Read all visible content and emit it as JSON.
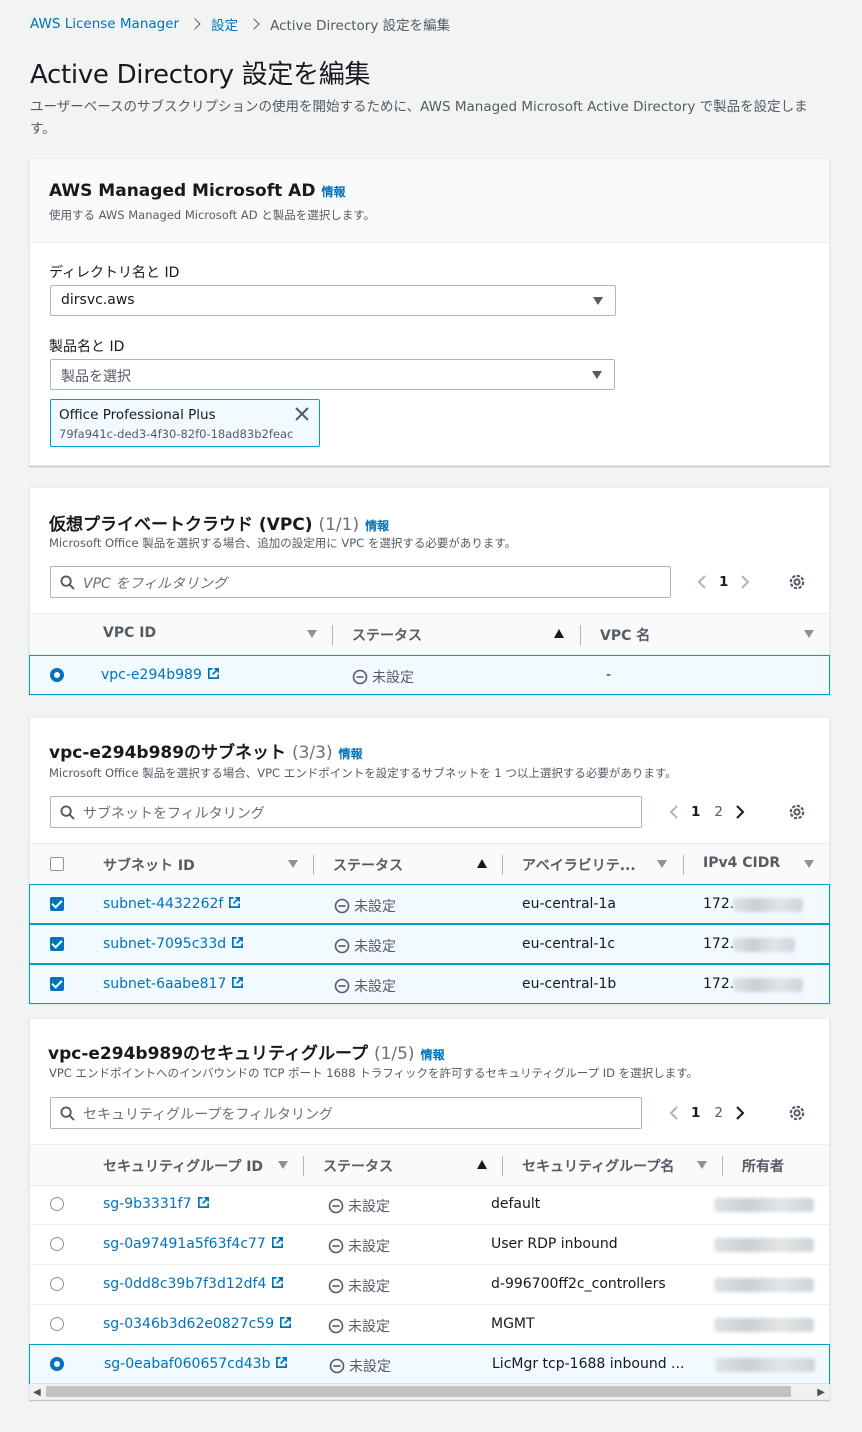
{
  "breadcrumb": {
    "items": [
      "AWS License Manager",
      "設定"
    ],
    "current": "Active Directory 設定を編集"
  },
  "page": {
    "title": "Active Directory 設定を編集",
    "description": "ユーザーベースのサブスクリプションの使用を開始するために、AWS Managed Microsoft Active Directory で製品を設定します。"
  },
  "ad_panel": {
    "title": "AWS Managed Microsoft AD",
    "info": "情報",
    "subtitle": "使用する AWS Managed Microsoft AD と製品を選択します。",
    "directory_label": "ディレクトリ名と ID",
    "directory_value": "dirsvc.aws",
    "product_label": "製品名と ID",
    "product_placeholder": "製品を選択",
    "token_name": "Office Professional Plus",
    "token_id": "79fa941c-ded3-4f30-82f0-18ad83b2feac"
  },
  "vpc_panel": {
    "title": "仮想プライベートクラウド (VPC)",
    "count": "(1/1)",
    "info": "情報",
    "subtitle": "Microsoft Office 製品を選択する場合、追加の設定用に VPC を選択する必要があります。",
    "filter_placeholder": "VPC をフィルタリング",
    "pages": [
      "1"
    ],
    "columns": [
      "VPC ID",
      "ステータス",
      "VPC 名"
    ],
    "rows": [
      {
        "id": "vpc-e294b989",
        "status": "未設定",
        "name": "-"
      }
    ]
  },
  "subnet_panel": {
    "title": "vpc-e294b989のサブネット",
    "count": "(3/3)",
    "info": "情報",
    "subtitle": "Microsoft Office 製品を選択する場合、VPC エンドポイントを設定するサブネットを 1 つ以上選択する必要があります。",
    "filter_placeholder": "サブネットをフィルタリング",
    "pages": [
      "1",
      "2"
    ],
    "columns": [
      "サブネット ID",
      "ステータス",
      "アベイラビリテ...",
      "IPv4 CIDR"
    ],
    "rows": [
      {
        "id": "subnet-4432262f",
        "status": "未設定",
        "az": "eu-central-1a",
        "cidr": "172."
      },
      {
        "id": "subnet-7095c33d",
        "status": "未設定",
        "az": "eu-central-1c",
        "cidr": "172."
      },
      {
        "id": "subnet-6aabe817",
        "status": "未設定",
        "az": "eu-central-1b",
        "cidr": "172."
      }
    ]
  },
  "sg_panel": {
    "title": "vpc-e294b989のセキュリティグループ",
    "count": "(1/5)",
    "info": "情報",
    "subtitle": "VPC エンドポイントへのインバウンドの TCP ポート 1688 トラフィックを許可するセキュリティグループ ID を選択します。",
    "filter_placeholder": "セキュリティグループをフィルタリング",
    "pages": [
      "1",
      "2"
    ],
    "columns": [
      "セキュリティグループ ID",
      "ステータス",
      "セキュリティグループ名",
      "所有者"
    ],
    "rows": [
      {
        "id": "sg-9b3331f7",
        "status": "未設定",
        "name": "default"
      },
      {
        "id": "sg-0a97491a5f63f4c77",
        "status": "未設定",
        "name": "User RDP inbound"
      },
      {
        "id": "sg-0dd8c39b7f3d12df4",
        "status": "未設定",
        "name": "d-996700ff2c_controllers"
      },
      {
        "id": "sg-0346b3d62e0827c59",
        "status": "未設定",
        "name": "MGMT"
      },
      {
        "id": "sg-0eabaf060657cd43b",
        "status": "未設定",
        "name": "LicMgr tcp-1688 inbound ..."
      }
    ]
  },
  "colors": {
    "link": "#0073bb",
    "selected_border": "#00a1c9",
    "selected_bg": "#f1faff",
    "background": "#f2f3f3"
  },
  "icons": [
    "chevron-right-icon",
    "caret-down-icon",
    "close-icon",
    "search-icon",
    "chevron-left-icon",
    "gear-icon",
    "external-link-icon",
    "status-minus-icon",
    "sort-icon"
  ]
}
